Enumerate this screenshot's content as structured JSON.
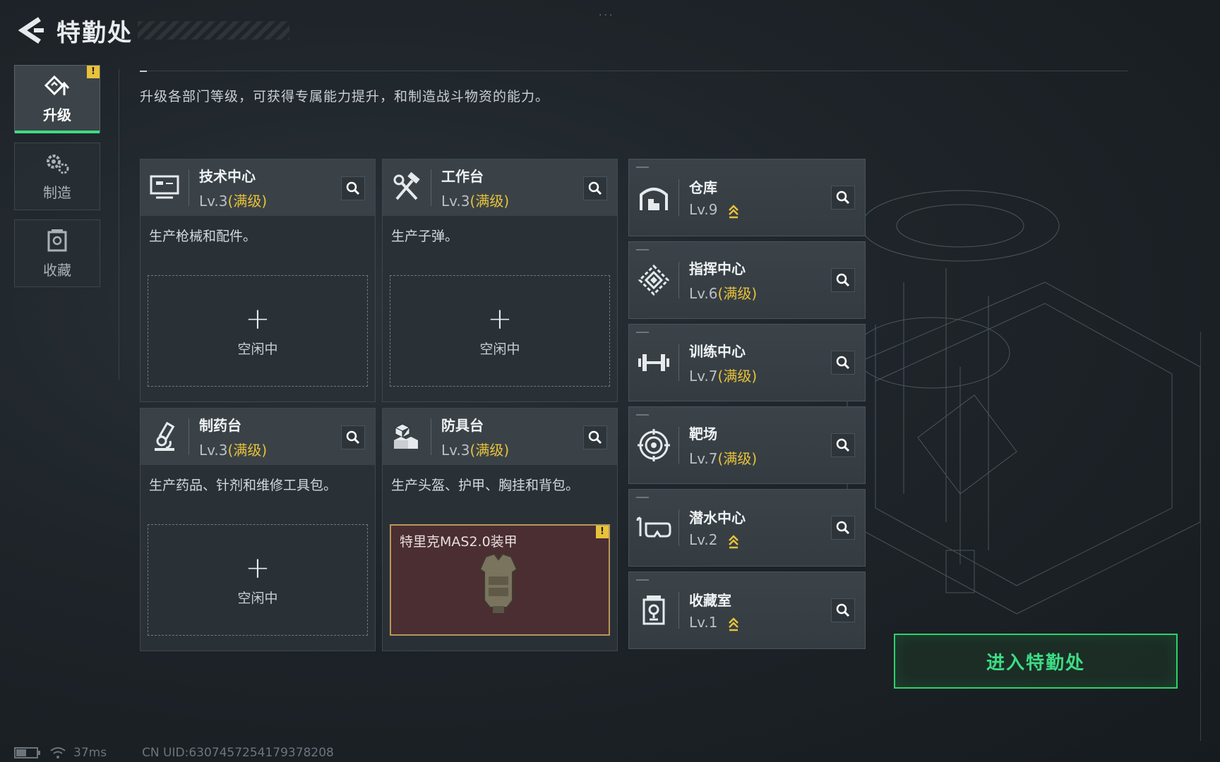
{
  "header": {
    "title": "特勤处",
    "dots": "..."
  },
  "tabs": [
    {
      "label": "升级",
      "icon": "upgrade-icon",
      "active": true,
      "badge": "!"
    },
    {
      "label": "制造",
      "icon": "gears-icon",
      "active": false
    },
    {
      "label": "收藏",
      "icon": "collection-icon",
      "active": false
    }
  ],
  "description": "升级各部门等级，可获得专属能力提升，和制造战斗物资的能力。",
  "production": [
    {
      "name": "技术中心",
      "level": "Lv.3",
      "max": "(满级)",
      "desc": "生产枪械和配件。",
      "slot_plus": "+",
      "slot_status": "空闲中",
      "icon": "computer-icon"
    },
    {
      "name": "工作台",
      "level": "Lv.3",
      "max": "(满级)",
      "desc": "生产子弹。",
      "slot_plus": "+",
      "slot_status": "空闲中",
      "icon": "tools-icon"
    },
    {
      "name": "制药台",
      "level": "Lv.3",
      "max": "(满级)",
      "desc": "生产药品、针剂和维修工具包。",
      "slot_plus": "+",
      "slot_status": "空闲中",
      "icon": "microscope-icon"
    },
    {
      "name": "防具台",
      "level": "Lv.3",
      "max": "(满级)",
      "desc": "生产头盔、护甲、胸挂和背包。",
      "item_name": "特里克MAS2.0装甲",
      "item_badge": "!",
      "icon": "blocks-icon"
    }
  ],
  "facilities": [
    {
      "name": "仓库",
      "level": "Lv.9",
      "max": "",
      "upgradable": true,
      "icon": "warehouse-icon"
    },
    {
      "name": "指挥中心",
      "level": "Lv.6",
      "max": "(满级)",
      "upgradable": false,
      "icon": "command-icon"
    },
    {
      "name": "训练中心",
      "level": "Lv.7",
      "max": "(满级)",
      "upgradable": false,
      "icon": "dumbbell-icon"
    },
    {
      "name": "靶场",
      "level": "Lv.7",
      "max": "(满级)",
      "upgradable": false,
      "icon": "target-icon"
    },
    {
      "name": "潜水中心",
      "level": "Lv.2",
      "max": "",
      "upgradable": true,
      "icon": "diving-mask-icon"
    },
    {
      "name": "收藏室",
      "level": "Lv.1",
      "max": "",
      "upgradable": true,
      "icon": "trophy-case-icon"
    }
  ],
  "enter_button": "进入特勤处",
  "footer": {
    "ping": "37ms",
    "uid": "CN UID:6307457254179378208"
  },
  "colors": {
    "accent_green": "#3ddc84",
    "max_yellow": "#e8c23a",
    "slot_red": "#4a2e32"
  }
}
